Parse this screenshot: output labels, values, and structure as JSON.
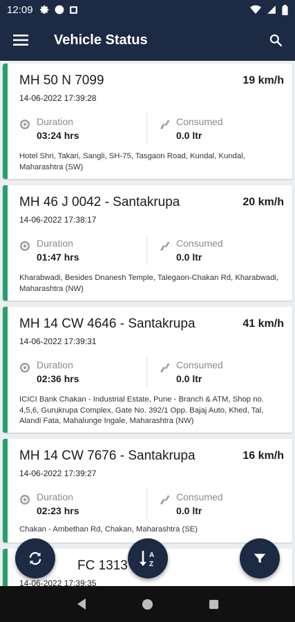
{
  "status_bar": {
    "time": "12:09",
    "left_icons": [
      "gear-icon",
      "circle-icon",
      "square-icon"
    ],
    "right_icons": [
      "wifi-icon",
      "signal-icon",
      "battery-icon"
    ]
  },
  "app_bar": {
    "title": "Vehicle Status",
    "menu_icon": "menu-icon",
    "search_icon": "search-icon"
  },
  "labels": {
    "duration": "Duration",
    "consumed": "Consumed"
  },
  "vehicles": [
    {
      "reg": "MH 50 N 7099",
      "speed": "19 km/h",
      "time": "14-06-2022 17:39:28",
      "duration": "03:24 hrs",
      "consumed": "0.0 ltr",
      "address": "Hotel Shri, Takari, Sangli, SH-75, Tasgaon Road, Kundal, Kundal, Maharashtra (SW)"
    },
    {
      "reg": "MH 46 J 0042 - Santakrupa",
      "speed": "20 km/h",
      "time": "14-06-2022 17:38:17",
      "duration": "01:47 hrs",
      "consumed": "0.0 ltr",
      "address": "Kharabwadi, Besides Dnanesh Temple, Talegaon-Chakan Rd, Kharabwadi, Maharashtra (NW)"
    },
    {
      "reg": "MH 14 CW 4646 - Santakrupa",
      "speed": "41 km/h",
      "time": "14-06-2022 17:39:31",
      "duration": "02:36 hrs",
      "consumed": "0.0 ltr",
      "address": "ICICI Bank Chakan - Industrial Estate, Pune - Branch & ATM, Shop no. 4,5,6, Gurukrupa Complex, Gate No. 392/1 Opp. Bajaj Auto, Khed, Tal, Alandi Fata, Mahalunge Ingale, Maharashtra (NW)"
    },
    {
      "reg": "MH 14 CW 7676 - Santakrupa",
      "speed": "16 km/h",
      "time": "14-06-2022 17:39:27",
      "duration": "02:23 hrs",
      "consumed": "0.0 ltr",
      "address": "Chakan - Ambethan Rd, Chakan, Maharashtra (SE)"
    },
    {
      "reg": "FC 1313",
      "time": "14-06-2022 17:39:35"
    }
  ],
  "fabs": {
    "refresh_icon": "refresh-icon",
    "sort_icon": "sort-az-icon",
    "filter_icon": "filter-icon"
  },
  "nav_bar": {
    "icons": [
      "back-icon",
      "home-icon",
      "recents-icon"
    ]
  },
  "colors": {
    "primary": "#1c2a44",
    "accent": "#27a069",
    "background": "#eceff1"
  }
}
